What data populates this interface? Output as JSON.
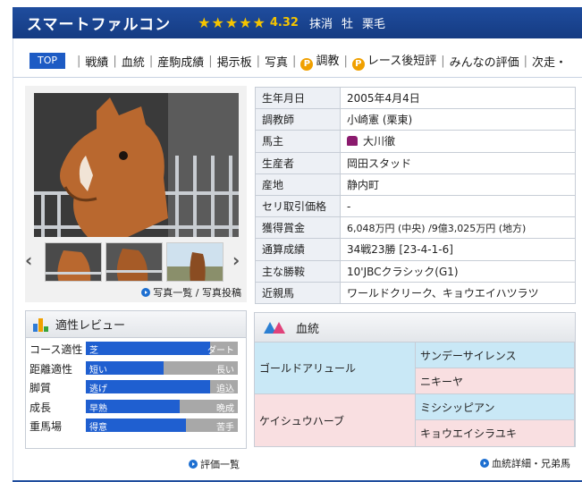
{
  "header": {
    "horse_name": "スマートファルコン",
    "star_count": 5,
    "rating": "4.32",
    "status": "抹消",
    "sex": "牡",
    "coat": "栗毛"
  },
  "nav": {
    "top": "TOP",
    "items": [
      "戦績",
      "血統",
      "産駒成績",
      "掲示板",
      "写真"
    ],
    "chokyo": "調教",
    "race_review": "レース後短評",
    "everyone": "みんなの評価",
    "next": "次走・"
  },
  "photo": {
    "links_a": "写真一覧",
    "links_sep": " / ",
    "links_b": "写真投稿",
    "prev_icon": "chevron-left-icon",
    "next_icon": "chevron-right-icon"
  },
  "profile": [
    {
      "key": "生年月日",
      "value": "2005年4月4日"
    },
    {
      "key": "調教師",
      "value": "小崎憲 (栗東)"
    },
    {
      "key": "馬主",
      "value": "大川徹"
    },
    {
      "key": "生産者",
      "value": "岡田スタッド"
    },
    {
      "key": "産地",
      "value": "静内町"
    },
    {
      "key": "セリ取引価格",
      "value": "-"
    },
    {
      "key": "獲得賞金",
      "value": "6,048万円 (中央) /9億3,025万円 (地方)"
    },
    {
      "key": "通算成績",
      "value": "34戦23勝 [23-4-1-6]"
    },
    {
      "key": "主な勝鞍",
      "value": "10'JBCクラシック(G1)"
    },
    {
      "key": "近親馬",
      "value": "ワールドクリーク、キョウエイハツラツ"
    }
  ],
  "review": {
    "title": "適性レビュー",
    "rows": [
      {
        "label": "コース適性",
        "left": "芝",
        "right": "ダート",
        "level": 0.82
      },
      {
        "label": "距離適性",
        "left": "短い",
        "right": "長い",
        "level": 0.51
      },
      {
        "label": "脚質",
        "left": "逃げ",
        "right": "追込",
        "level": 0.82
      },
      {
        "label": "成長",
        "left": "早熟",
        "right": "晩成",
        "level": 0.62
      },
      {
        "label": "重馬場",
        "left": "得意",
        "right": "苦手",
        "level": 0.66
      }
    ],
    "link": "評価一覧"
  },
  "pedigree": {
    "title": "血統",
    "sire": "ゴールドアリュール",
    "sire_sire": "サンデーサイレンス",
    "sire_dam": "ニキーヤ",
    "dam": "ケイシュウハーブ",
    "dam_sire": "ミシシッピアン",
    "dam_dam": "キョウエイシラユキ",
    "link": "血統詳細・兄弟馬"
  },
  "colors": {
    "header": "#1f4d9e",
    "accent": "#1d5bc4",
    "star": "#f5c400",
    "sire_bg": "#c9e8f6",
    "dam_bg": "#f9dfe1"
  }
}
